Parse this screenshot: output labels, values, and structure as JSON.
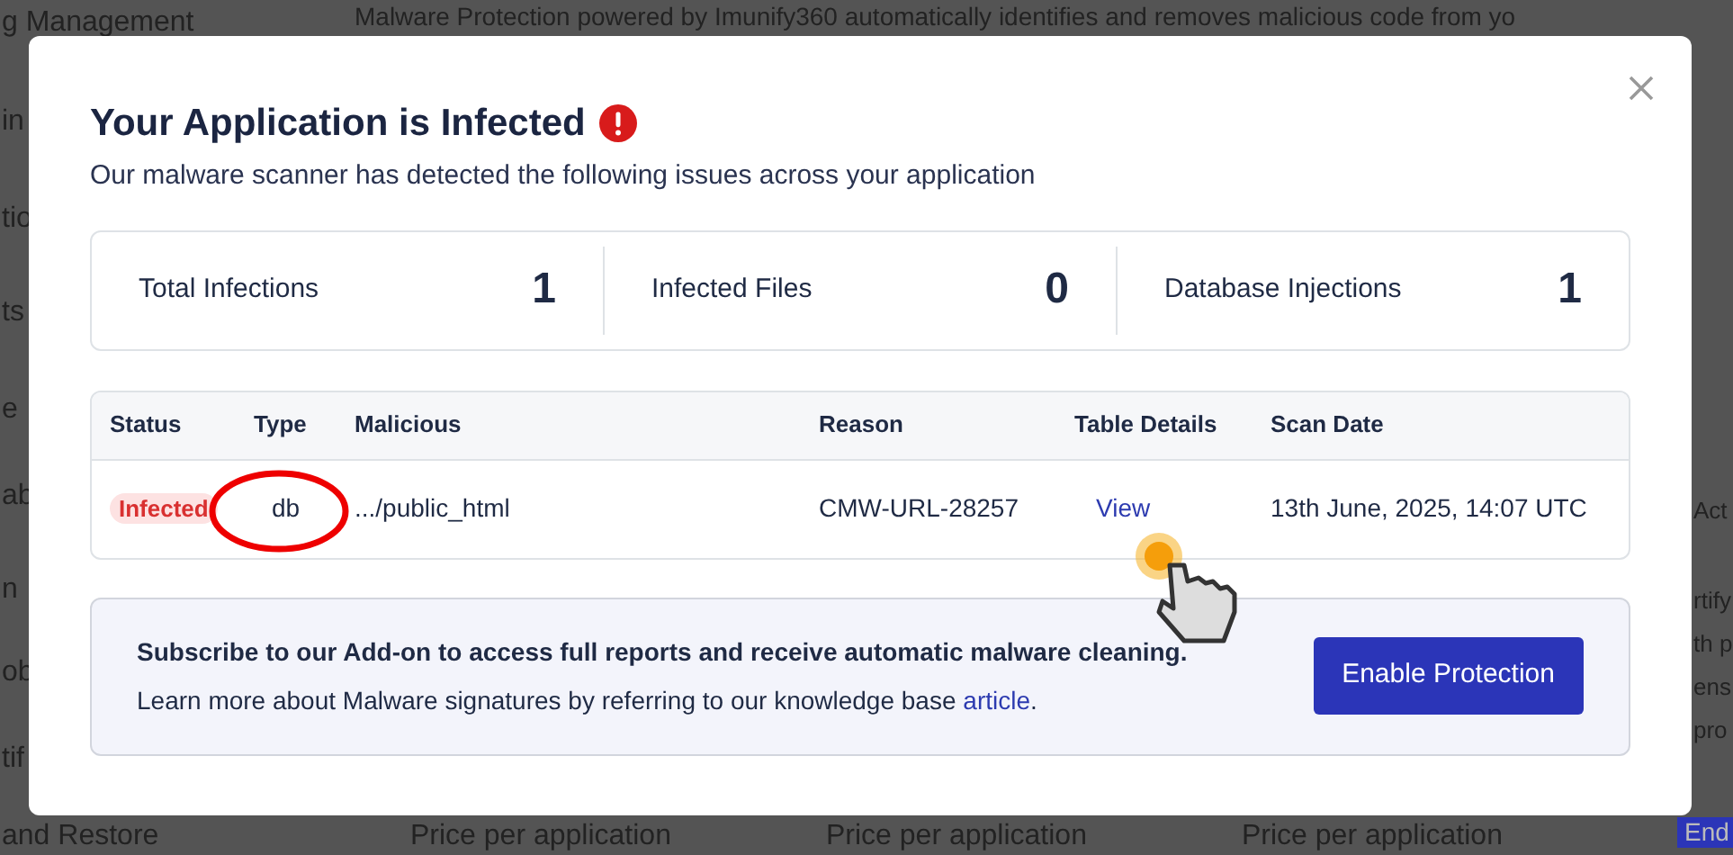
{
  "background": {
    "sidebar_items": [
      "g Management",
      "in",
      "tio",
      "ts",
      "e",
      "ab",
      "n",
      "ob",
      "tif",
      "and Restore"
    ],
    "intro": "Malware Protection powered by Imunify360 automatically identifies and removes malicious code from yo",
    "right_fragments": [
      "Act",
      "rtify",
      "th p",
      "ens",
      "pro"
    ],
    "prices": [
      "Price per application",
      "Price per application",
      "Price per application"
    ],
    "corner_button": "End"
  },
  "modal": {
    "title": "Your Application is Infected",
    "subtitle": "Our malware scanner has detected the following issues across your application",
    "stats": [
      {
        "label": "Total Infections",
        "value": "1"
      },
      {
        "label": "Infected Files",
        "value": "0"
      },
      {
        "label": "Database Injections",
        "value": "1"
      }
    ],
    "table": {
      "columns": [
        "Status",
        "Type",
        "Malicious",
        "Reason",
        "Table Details",
        "Scan Date"
      ],
      "rows": [
        {
          "status": "Infected",
          "type": "db",
          "malicious": ".../public_html",
          "reason": "CMW-URL-28257",
          "details": "View",
          "date": "13th June, 2025, 14:07 UTC"
        }
      ]
    },
    "promo": {
      "line1": "Subscribe to our Add-on to access full reports and receive automatic malware cleaning.",
      "line2": "Learn more about Malware signatures by referring to our knowledge base ",
      "link": "article",
      "after": ".",
      "button": "Enable Protection"
    }
  }
}
